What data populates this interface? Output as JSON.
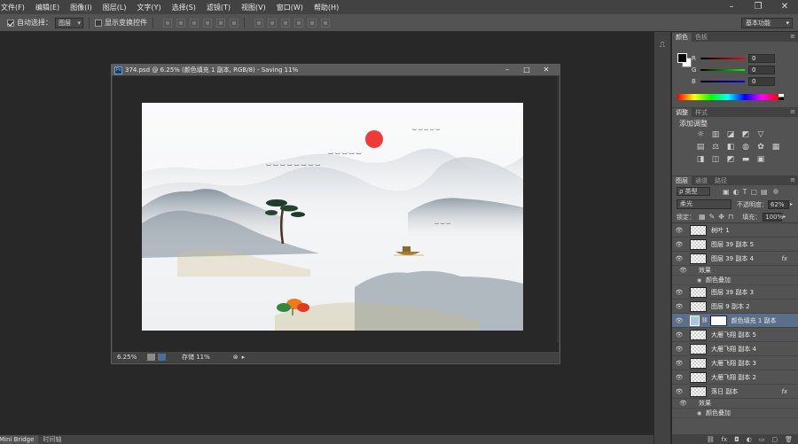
{
  "menubar": {
    "items": [
      "文件(F)",
      "编辑(E)",
      "图像(I)",
      "图层(L)",
      "文字(Y)",
      "选择(S)",
      "滤镜(T)",
      "视图(V)",
      "窗口(W)",
      "帮助(H)"
    ]
  },
  "optionsbar": {
    "auto_select_label": "自动选择：",
    "auto_select_value": "图层",
    "show_transform_label": "显示变换控件",
    "workspace": "基本功能"
  },
  "document": {
    "title": "374.psd @ 6.25% (颜色填充 1 副本, RGB/8) - Saving 11%",
    "zoom": "6.25%",
    "save_status": "存储 11%"
  },
  "color_panel": {
    "tabs": [
      "颜色",
      "色板"
    ],
    "channels": [
      {
        "label": "R",
        "value": "0",
        "color": "#c83232"
      },
      {
        "label": "G",
        "value": "0",
        "color": "#32a032"
      },
      {
        "label": "B",
        "value": "0",
        "color": "#3246c8"
      }
    ]
  },
  "adjust_panel": {
    "tabs": [
      "调整",
      "样式"
    ],
    "heading": "添加调整",
    "icons": [
      "brightness-icon",
      "levels-icon",
      "curves-icon",
      "exposure-icon",
      "vibrance-icon",
      "hue-icon",
      "color-balance-icon",
      "bw-icon",
      "photo-filter-icon",
      "channel-mixer-icon",
      "color-lookup-icon",
      "invert-icon",
      "posterize-icon",
      "threshold-icon",
      "gradient-map-icon",
      "selective-color-icon"
    ]
  },
  "layers_panel": {
    "tabs": [
      "图层",
      "通道",
      "路径"
    ],
    "filter_kind": "类型",
    "blend_mode": "柔光",
    "opacity_label": "不透明度：",
    "opacity_value": "62%",
    "lock_label": "锁定：",
    "fill_label": "填充：",
    "fill_value": "100%",
    "layers": [
      {
        "name": "树叶 1",
        "fx": ""
      },
      {
        "name": "图层 39 副本 5",
        "fx": ""
      },
      {
        "name": "图层 39 副本 4",
        "fx": "fx"
      }
    ],
    "effects_label": "效果",
    "color_overlay_label": "颜色叠加",
    "layers2": [
      {
        "name": "图层 39 副本 3",
        "fx": ""
      },
      {
        "name": "图层 9 副本 2",
        "fx": ""
      }
    ],
    "selected_layer": "颜色填充 1 副本",
    "layers3": [
      {
        "name": "大雁飞翔 副本 5",
        "fx": ""
      },
      {
        "name": "大雁飞翔 副本 4",
        "fx": ""
      },
      {
        "name": "大雁飞翔 副本 3",
        "fx": ""
      },
      {
        "name": "大雁飞翔 副本 2",
        "fx": ""
      }
    ],
    "last_layer": "落日 副本",
    "last_layer_fx": "fx"
  },
  "bottom_tabs": [
    "Mini Bridge",
    "时间轴"
  ]
}
